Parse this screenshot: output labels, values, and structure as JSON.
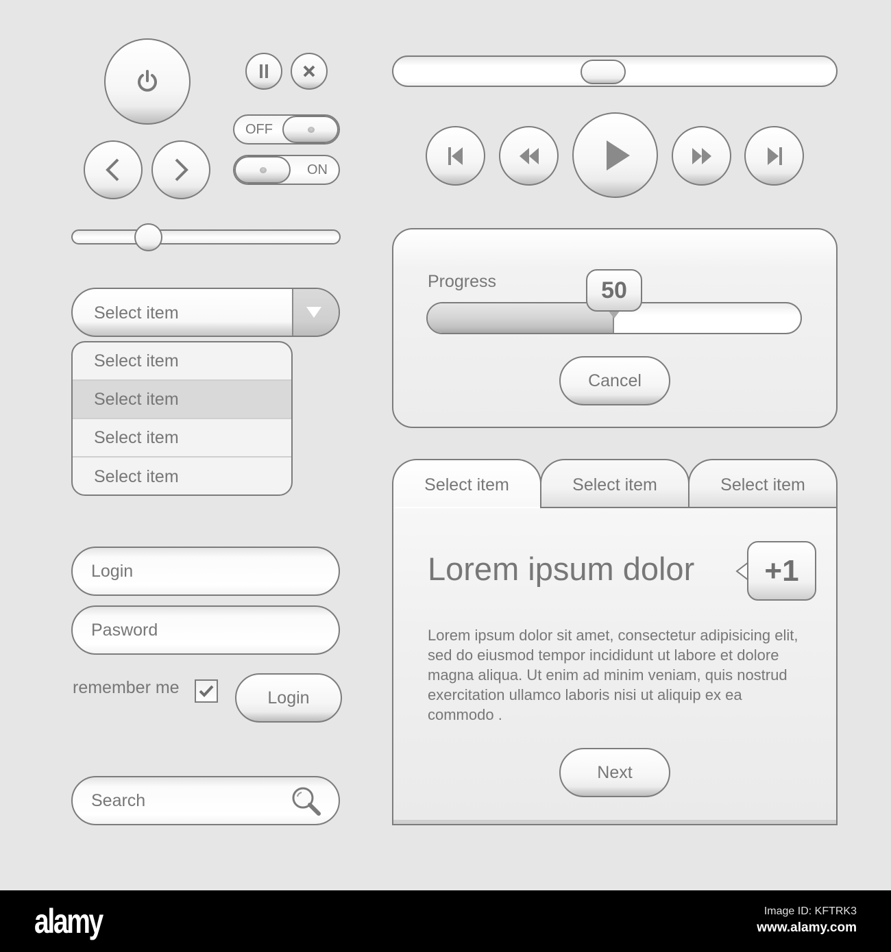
{
  "controls": {
    "power_icon": "power-icon",
    "pause_icon": "pause-icon",
    "close_icon": "close-icon",
    "prev_icon": "chevron-left-icon",
    "next_icon": "chevron-right-icon"
  },
  "toggles": [
    {
      "label": "OFF",
      "state": "off"
    },
    {
      "label": "ON",
      "state": "on"
    }
  ],
  "slider": {
    "value_fraction": 0.26
  },
  "dropdown": {
    "selected": "Select item",
    "options": [
      "Select item",
      "Select item",
      "Select item",
      "Select item"
    ],
    "highlighted_index": 1
  },
  "login_form": {
    "login_placeholder": "Login",
    "password_placeholder": "Pasword",
    "remember_label": "remember me",
    "remember_checked": true,
    "submit_label": "Login"
  },
  "search": {
    "placeholder": "Search"
  },
  "scrollbar": {
    "position_fraction": 0.47
  },
  "media": {
    "buttons": [
      "skip-back",
      "rewind",
      "play",
      "fast-forward",
      "skip-forward"
    ]
  },
  "progress_panel": {
    "label": "Progress",
    "value": 50,
    "value_text": "50",
    "cancel_label": "Cancel"
  },
  "tabs_panel": {
    "tabs": [
      {
        "label": "Select item",
        "active": true
      },
      {
        "label": "Select item",
        "active": false
      },
      {
        "label": "Select item",
        "active": false
      }
    ],
    "heading": "Lorem ipsum dolor",
    "badge": "+1",
    "body": "Lorem ipsum dolor sit amet, consectetur adipisicing elit, sed do eiusmod tempor incididunt ut labore et dolore magna aliqua. Ut enim ad minim veniam, quis nostrud exercitation ullamco laboris nisi ut aliquip ex ea commodo .",
    "next_label": "Next"
  },
  "footer": {
    "logo": "alamy",
    "image_id": "Image ID: KFTRK3",
    "url": "www.alamy.com"
  },
  "colors": {
    "background": "#e6e6e6",
    "border": "#7c7c7c",
    "text": "#777777",
    "footer": "#000000"
  }
}
